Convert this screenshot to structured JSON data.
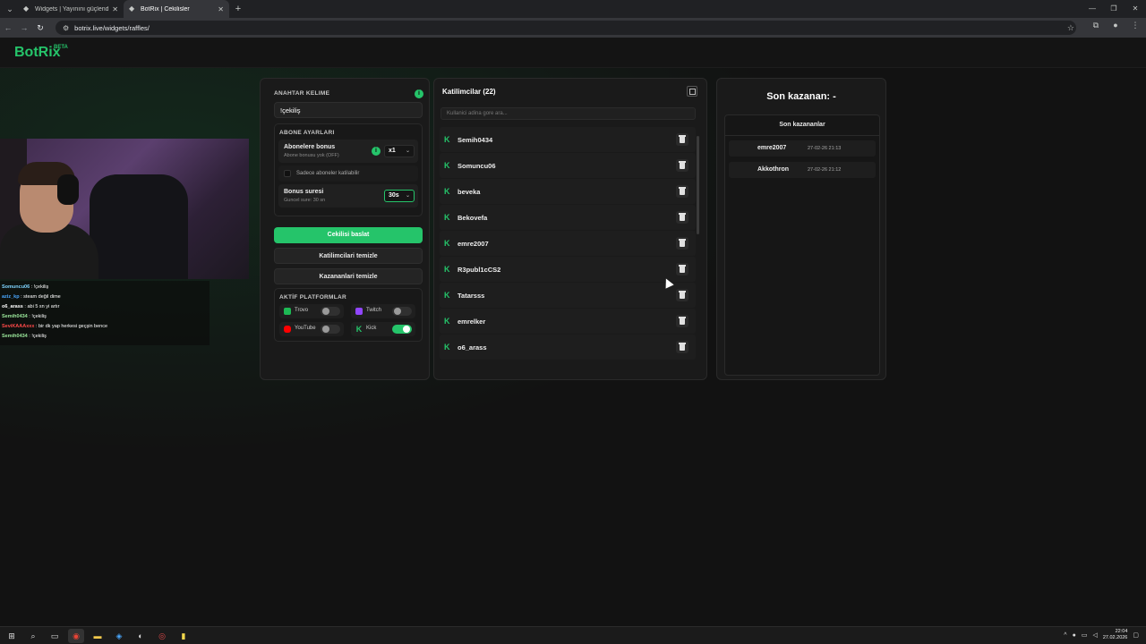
{
  "browser": {
    "tabs": [
      {
        "title": "Widgets | Yayınını güçlendirmek",
        "active": false
      },
      {
        "title": "BotRix | Cekilisler",
        "active": true
      }
    ],
    "url": "botrix.live/widgets/raffles/"
  },
  "brand": {
    "name": "BotRix",
    "badge": "BETA",
    "color": "#25c46a"
  },
  "chat": [
    {
      "user": "Somuncu06",
      "msg": ": !çekiliş",
      "color": "#7fd4ff"
    },
    {
      "user": "aziz_kp",
      "msg": ": steam değil dime",
      "color": "#4aa8ff"
    },
    {
      "user": "o6_arass",
      "msg": ": abi 5 sn yi artır",
      "color": "#ffffff"
    },
    {
      "user": "Semih0434",
      "msg": ": !çekiliş",
      "color": "#9be89b"
    },
    {
      "user": "SeviKAAAxxx",
      "msg": ": bir dk yap herkesi geçşin bence",
      "color": "#ff4a4a"
    },
    {
      "user": "Semih0434",
      "msg": ": !çekiliş",
      "color": "#9be89b"
    }
  ],
  "settings": {
    "keyword_label": "ANAHTAR KELIME",
    "keyword_value": "!çekiliş",
    "sub_label": "ABONE AYARLARI",
    "bonus_title": "Abonelere bonus",
    "bonus_sub": "Abone bonusu yok (OFF)",
    "bonus_value": "x1",
    "only_subs": "Sadece aboneler katilabilir",
    "bonus_time_title": "Bonus suresi",
    "bonus_time_sub": "Guncel sure: 30 sn",
    "bonus_time_value": "30s",
    "btn_start": "Cekilisi baslat",
    "btn_clear_parts": "Katilimcilari temizle",
    "btn_clear_winners": "Kazananlari temizle",
    "platforms_label": "AKTİF PLATFORMLAR",
    "platforms": [
      {
        "name": "Trovo",
        "on": false,
        "color": "#1db954"
      },
      {
        "name": "Twitch",
        "on": false,
        "color": "#9146ff"
      },
      {
        "name": "YouTube",
        "on": false,
        "color": "#ff0000"
      },
      {
        "name": "Kick",
        "on": true,
        "color": "#25c46a"
      }
    ]
  },
  "participants": {
    "title": "Katilimcilar (22)",
    "search_placeholder": "Kullanici adina gore ara...",
    "items": [
      "Semih0434",
      "Somuncu06",
      "beveka",
      "Bekovefa",
      "emre2007",
      "R3publ1cCS2",
      "Tatarsss",
      "emrelker",
      "o6_arass"
    ]
  },
  "winners": {
    "headline": "Son kazanan: -",
    "list_title": "Son kazananlar",
    "items": [
      {
        "name": "emre2007",
        "date": "27-02-26 21:13"
      },
      {
        "name": "Akkothron",
        "date": "27-02-26 21:12"
      }
    ]
  },
  "taskbar": {
    "time": "22:04",
    "date": "27.02.2026"
  }
}
